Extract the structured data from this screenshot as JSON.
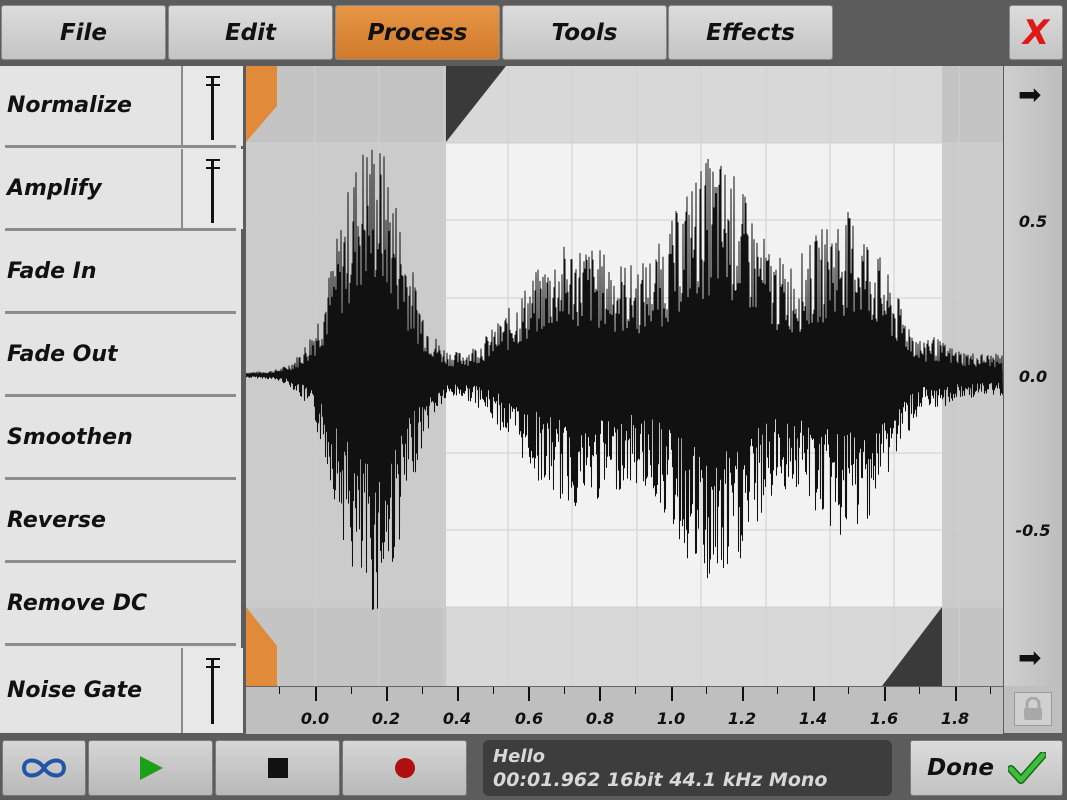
{
  "menu": {
    "items": [
      {
        "label": "File"
      },
      {
        "label": "Edit"
      },
      {
        "label": "Process"
      },
      {
        "label": "Tools"
      },
      {
        "label": "Effects"
      }
    ],
    "active": "Process",
    "close_label": "X"
  },
  "process_list": [
    {
      "label": "Normalize",
      "has_slider": true
    },
    {
      "label": "Amplify",
      "has_slider": true
    },
    {
      "label": "Fade In",
      "has_slider": false
    },
    {
      "label": "Fade Out",
      "has_slider": false
    },
    {
      "label": "Smoothen",
      "has_slider": false
    },
    {
      "label": "Reverse",
      "has_slider": false
    },
    {
      "label": "Remove DC",
      "has_slider": false
    },
    {
      "label": "Noise Gate",
      "has_slider": true
    }
  ],
  "waveform": {
    "y_labels": [
      "0.5",
      "0.0",
      "-0.5"
    ],
    "time_labels": [
      "0.0",
      "0.2",
      "0.4",
      "0.6",
      "0.8",
      "1.0",
      "1.2",
      "1.4",
      "1.6",
      "1.8"
    ],
    "selection_start_s": 0.37,
    "selection_end_s": 1.77,
    "total_s": 1.962,
    "icons": {
      "arrow_top": "arrow-right-icon",
      "arrow_bottom": "arrow-right-icon",
      "lock": "lock-icon"
    }
  },
  "transport": {
    "loop_icon": "infinity-icon",
    "play_icon": "play-icon",
    "stop_icon": "stop-icon",
    "record_icon": "record-icon"
  },
  "status": {
    "name": "Hello",
    "info": "00:01.962 16bit 44.1 kHz Mono"
  },
  "done": {
    "label": "Done",
    "icon": "checkmark-icon"
  },
  "colors": {
    "accent": "#e08a3a",
    "close": "#e01818",
    "play": "#1aa01a",
    "record": "#b01010",
    "check": "#2ca02c",
    "loop": "#2255a5"
  }
}
